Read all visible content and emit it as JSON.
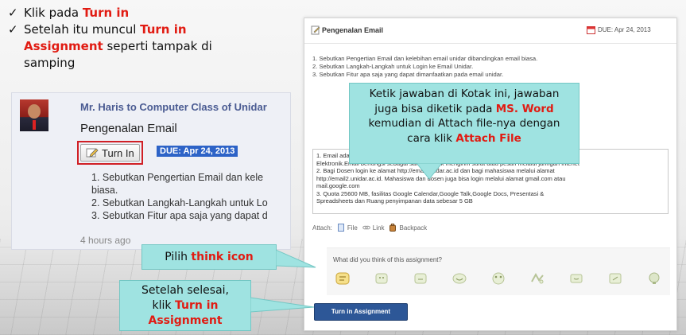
{
  "instructions": {
    "line1_pre": "Klik pada ",
    "line1_red": "Turn in",
    "line2_pre": "Setelah itu muncul ",
    "line2_red1": "Turn in",
    "line2_red2": "Assignment",
    "line2_post": " seperti tampak di",
    "line2_tail": "samping"
  },
  "stream": {
    "author": "Mr. Haris to Computer Class of Unidar",
    "title": "Pengenalan Email",
    "turn_in_label": "Turn In",
    "due_badge": "DUE: Apr 24, 2013",
    "questions": [
      "1. Sebutkan Pengertian Email dan kele",
      "biasa.",
      "2. Sebutkan Langkah-Langkah untuk Lo",
      "3. Sebutkan Fitur apa saja yang dapat d"
    ],
    "time": "4 hours ago"
  },
  "panel": {
    "title": "Pengenalan Email",
    "due": "DUE: Apr 24, 2013",
    "questions": [
      "1. Sebutkan Pengertian Email dan kelebihan email unidar dibandingkan email biasa.",
      "2. Sebutkan Langkah-Langkah untuk Login ke Email Unidar.",
      "3. Sebutkan Fitur apa saja yang dapat dimanfaatkan pada email unidar."
    ],
    "answer_lines": [
      "1. Email adalah singkatan dari Electronic Mail dan kalau di bahasa ...alanya adalah Surat",
      "Elektronik.Email berfungsi sebagai sarana untuk mengirim surat atau pesan melalui jaringan Intenet",
      "2. Bagi Dosen login ke alamat http://email.unidar.ac.id dan bagi mahasiswa melalui alamat",
      "http://email2.unidar.ac.id. Mahasiswa dan dosen juga bisa login melalui alamat gmail.com atau",
      "mail.google.com",
      "3. Quota 25600 MB, fasilitas  Google Calendar,Google Talk,Google Docs, Presentasi &",
      "Spreadsheets dan Ruang penyimpanan data sebesar 5 GB"
    ],
    "attach_label": "Attach:",
    "attach_file": "File",
    "attach_link": "Link",
    "attach_backpack": "Backpack",
    "think_question": "What did you think of this assignment?",
    "think_icons": [
      "think-icon-1",
      "think-icon-2",
      "think-icon-3",
      "think-icon-4",
      "think-icon-5",
      "think-icon-6",
      "think-icon-7",
      "think-icon-8",
      "think-icon-9"
    ],
    "submit_label": "Turn in Assignment"
  },
  "callouts": {
    "c1_line1": "Ketik jawaban di Kotak ini, jawaban",
    "c1_line2_pre": "juga bisa diketik pada ",
    "c1_line2_red": "MS. Word",
    "c1_line3": "kemudian di Attach file-nya dengan",
    "c1_line4_pre": "cara klik ",
    "c1_line4_red": "Attach  File",
    "c2_pre": "Pilih ",
    "c2_red": "think icon",
    "c3_line1": "Setelah selesai,",
    "c3_line2_pre": "klik ",
    "c3_line2_red": "Turn in",
    "c3_line3_red": "Assignment"
  },
  "colors": {
    "highlight_red": "#e11b12",
    "callout_bg": "#9fe3e1",
    "due_badge": "#2d63c7",
    "submit_button": "#2d5797"
  }
}
